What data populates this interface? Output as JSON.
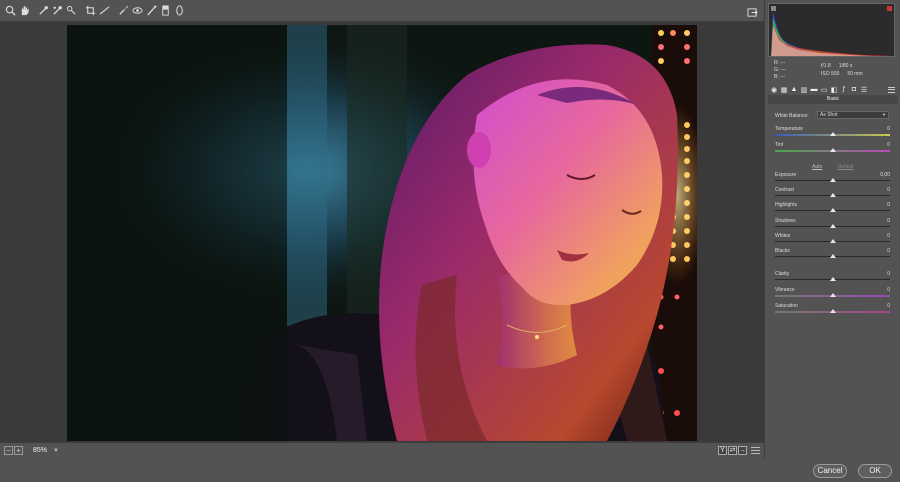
{
  "toolbar": {
    "tools": [
      "zoom-icon",
      "hand-icon",
      "white-balance-icon",
      "color-sampler-icon",
      "targeted-adjustment-icon",
      "crop-icon",
      "straighten-icon",
      "spot-removal-icon",
      "red-eye-icon",
      "adjustment-brush-icon",
      "graduated-filter-icon",
      "radial-filter-icon"
    ]
  },
  "status": {
    "zoom": "85%"
  },
  "footer": {
    "cancel_label": "Cancel",
    "ok_label": "OK"
  },
  "readout": {
    "r": "R:   ---",
    "g": "G:   ---",
    "b": "B:   ---",
    "aperture": "f/1.8",
    "shutter": "1/80 s",
    "iso": "ISO 500",
    "focal": "50 mm"
  },
  "panel": {
    "section_title": "Basic",
    "white_balance_label": "White Balance:",
    "white_balance_value": "As Shot",
    "auto_label": "Auto",
    "default_label": "Default"
  },
  "sliders": [
    {
      "label": "Temperature",
      "value": "0",
      "pos": 0.5
    },
    {
      "label": "Tint",
      "value": "0",
      "pos": 0.5
    },
    {
      "label": "Exposure",
      "value": "0,00",
      "pos": 0.5
    },
    {
      "label": "Contrast",
      "value": "0",
      "pos": 0.5
    },
    {
      "label": "Highlights",
      "value": "0",
      "pos": 0.5
    },
    {
      "label": "Shadows",
      "value": "0",
      "pos": 0.5
    },
    {
      "label": "Whites",
      "value": "0",
      "pos": 0.5
    },
    {
      "label": "Blacks",
      "value": "0",
      "pos": 0.5
    },
    {
      "label": "Clarity",
      "value": "0",
      "pos": 0.5
    },
    {
      "label": "Vibrance",
      "value": "0",
      "pos": 0.5
    },
    {
      "label": "Saturation",
      "value": "0",
      "pos": 0.5
    }
  ],
  "colors": {
    "panel_bg": "#535353",
    "canvas_bg": "#3a3a3a",
    "clip_highlight": "#cc3333"
  }
}
